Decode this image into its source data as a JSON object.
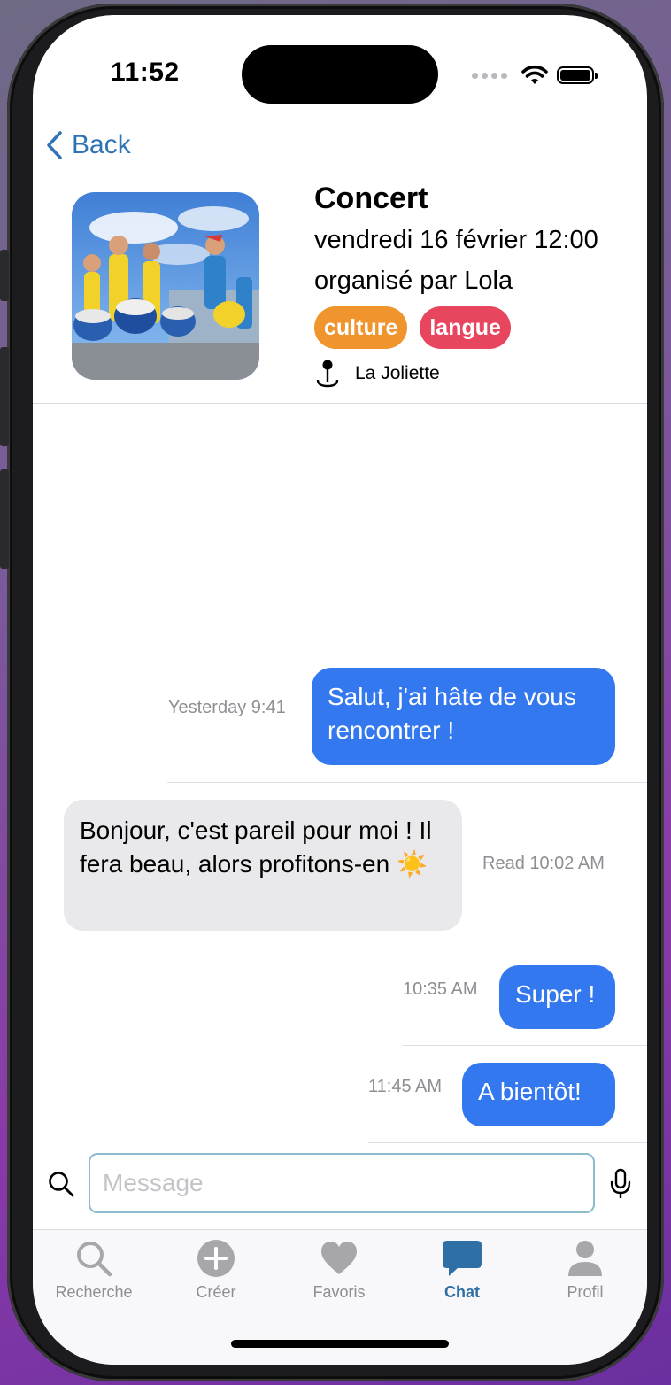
{
  "status_bar": {
    "time": "11:52"
  },
  "nav": {
    "back_label": "Back"
  },
  "event": {
    "title": "Concert",
    "date": "vendredi 16 février 12:00",
    "organizer": "organisé par Lola",
    "tags": [
      {
        "label": "culture",
        "color": "#f0952d"
      },
      {
        "label": "langue",
        "color": "#e8455f"
      }
    ],
    "location": "La Joliette"
  },
  "messages": [
    {
      "direction": "outgoing",
      "time": "Yesterday 9:41",
      "text": "Salut, j'ai hâte de vous rencontrer !"
    },
    {
      "direction": "incoming",
      "time": "Read 10:02 AM",
      "text": "Bonjour, c'est pareil pour moi ! Il fera beau, alors profitons-en ☀️"
    },
    {
      "direction": "outgoing",
      "time": "10:35 AM",
      "text": "Super !"
    },
    {
      "direction": "outgoing",
      "time": "11:45 AM",
      "text": "A bientôt!"
    }
  ],
  "composer": {
    "placeholder": "Message",
    "value": ""
  },
  "tabbar": {
    "tabs": [
      {
        "label": "Recherche",
        "icon": "search-icon",
        "active": false
      },
      {
        "label": "Créer",
        "icon": "plus-circle-icon",
        "active": false
      },
      {
        "label": "Favoris",
        "icon": "heart-icon",
        "active": false
      },
      {
        "label": "Chat",
        "icon": "chat-bubble-icon",
        "active": true
      },
      {
        "label": "Profil",
        "icon": "person-icon",
        "active": false
      }
    ]
  },
  "colors": {
    "accent": "#2e74b5",
    "outgoing_bubble": "#3478f0",
    "incoming_bubble": "#e9e9eb",
    "tab_active": "#2e6fa6",
    "tab_inactive": "#a7a7ab"
  }
}
